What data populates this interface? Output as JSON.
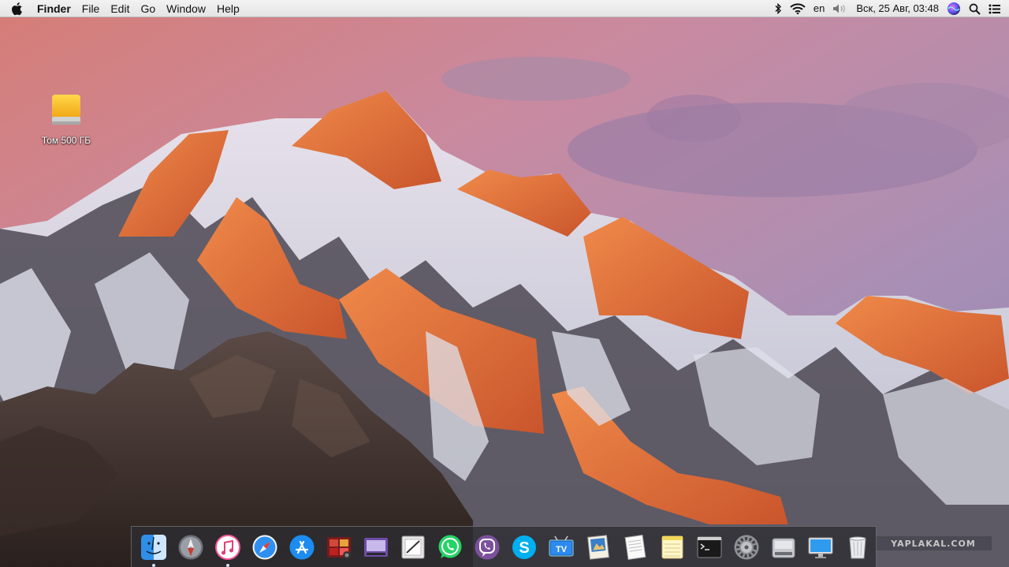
{
  "menubar": {
    "apple_icon": "apple-logo-icon",
    "app_name": "Finder",
    "menus": [
      "File",
      "Edit",
      "Go",
      "Window",
      "Help"
    ],
    "tray": {
      "bluetooth_icon": "bluetooth-icon",
      "wifi_icon": "wifi-icon",
      "input_language": "en",
      "volume_icon": "volume-icon",
      "clock": "Вск, 25 Авг, 03:48",
      "siri_icon": "siri-icon",
      "search_icon": "spotlight-search-icon",
      "notifications_icon": "notification-center-icon"
    }
  },
  "desktop": {
    "icons": [
      {
        "label": "Том 500 ГБ",
        "icon": "external-drive-icon"
      }
    ],
    "wallpaper": "sierra-mountain-sunset"
  },
  "watermark": "YAPLAKAL.COM",
  "dock": {
    "items": [
      {
        "name": "Finder",
        "icon": "finder-icon",
        "running": true
      },
      {
        "name": "Launchpad",
        "icon": "launchpad-icon",
        "running": false
      },
      {
        "name": "iTunes",
        "icon": "itunes-icon",
        "running": true
      },
      {
        "name": "Safari",
        "icon": "safari-icon",
        "running": false
      },
      {
        "name": "App Store",
        "icon": "app-store-icon",
        "running": false
      },
      {
        "name": "Photo Booth",
        "icon": "photo-booth-icon",
        "running": false
      },
      {
        "name": "Screenshot Viewer",
        "icon": "screenshot-viewer-icon",
        "running": false
      },
      {
        "name": "Preview",
        "icon": "preview-icon",
        "running": false
      },
      {
        "name": "WhatsApp",
        "icon": "whatsapp-icon",
        "running": false
      },
      {
        "name": "Viber",
        "icon": "viber-icon",
        "running": false
      },
      {
        "name": "Skype",
        "icon": "skype-icon",
        "running": false
      },
      {
        "name": "TV",
        "icon": "tv-icon",
        "running": false
      },
      {
        "name": "Image Capture",
        "icon": "image-capture-icon",
        "running": false
      },
      {
        "name": "TextEdit",
        "icon": "textedit-icon",
        "running": false
      },
      {
        "name": "Notes",
        "icon": "notes-icon",
        "running": false
      },
      {
        "name": "Terminal",
        "icon": "terminal-icon",
        "running": false
      },
      {
        "name": "System Preferences",
        "icon": "system-preferences-icon",
        "running": false
      },
      {
        "name": "Disk Utility",
        "icon": "disk-utility-icon",
        "running": false
      },
      {
        "name": "Desktop",
        "icon": "desktop-display-icon",
        "running": false
      },
      {
        "name": "Trash",
        "icon": "trash-icon",
        "running": false
      }
    ]
  },
  "colors": {
    "menubar_bg": "#ececec",
    "dock_bg": "#2d2d32",
    "sky_top": "#d98a86",
    "sky_mid": "#b78aa5",
    "mountain_glow": "#e8743f"
  }
}
